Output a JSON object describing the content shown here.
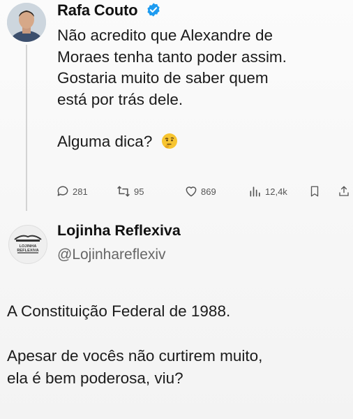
{
  "tweet1": {
    "author": "Rafa Couto",
    "verified_icon": "verified-badge-icon",
    "lines": [
      "Não acredito que Alexandre de",
      "Moraes tenha tanto poder assim.",
      "Gostaria muito de saber quem",
      "está por trás dele."
    ],
    "question": "Alguma dica?",
    "emoji_icon": "thinking-face-emoji",
    "stats": {
      "replies": "281",
      "retweets": "95",
      "likes": "869",
      "views": "12,4k"
    }
  },
  "tweet2": {
    "author": "Lojinha Reflexiva",
    "handle": "@Lojinhareflexiv",
    "lines": [
      "A Constituição Federal de 1988."
    ],
    "lines2": [
      "Apesar de vocês não curtirem muito,",
      "ela é bem poderosa, viu?"
    ]
  },
  "colors": {
    "verified_blue": "#1d9bf0",
    "text": "#1b1b1b",
    "muted": "#555555"
  }
}
